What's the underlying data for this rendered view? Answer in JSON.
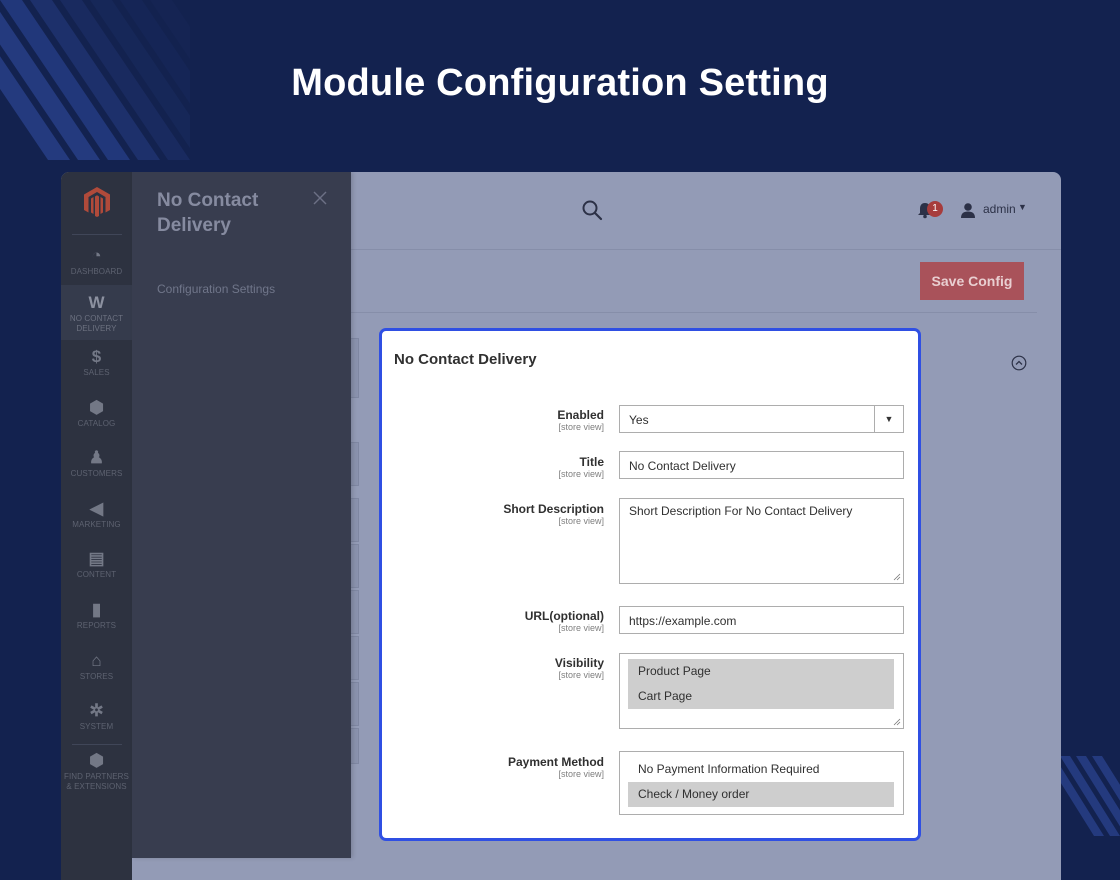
{
  "hero": {
    "title": "Module Configuration Setting"
  },
  "colors": {
    "background": "#13224f",
    "accent_border": "#2f4fe3",
    "save_button": "#a9525a",
    "nav": "#2d3240"
  },
  "header": {
    "notification_count": "1",
    "user": "admin",
    "save_button": "Save Config",
    "icons": [
      "search-icon",
      "bell-icon",
      "user-icon",
      "magento-logo-icon",
      "collapse-icon"
    ]
  },
  "nav": {
    "items": [
      {
        "label": "DASHBOARD",
        "icon": "dashboard-icon"
      },
      {
        "label": "NO CONTACT DELIVERY",
        "icon": "w-logo-icon"
      },
      {
        "label": "SALES",
        "icon": "dollar-icon"
      },
      {
        "label": "CATALOG",
        "icon": "cube-icon"
      },
      {
        "label": "CUSTOMERS",
        "icon": "person-icon"
      },
      {
        "label": "MARKETING",
        "icon": "megaphone-icon"
      },
      {
        "label": "CONTENT",
        "icon": "layout-icon"
      },
      {
        "label": "REPORTS",
        "icon": "bar-chart-icon"
      },
      {
        "label": "STORES",
        "icon": "store-icon"
      },
      {
        "label": "SYSTEM",
        "icon": "gear-icon"
      },
      {
        "label": "FIND PARTNERS & EXTENSIONS",
        "icon": "box-icon"
      }
    ]
  },
  "flyout": {
    "title": "No Contact Delivery",
    "link": "Configuration Settings"
  },
  "config": {
    "section_title": "No Contact Delivery",
    "scope_label": "[store view]",
    "fields": {
      "enabled": {
        "label": "Enabled",
        "value": "Yes"
      },
      "title": {
        "label": "Title",
        "value": "No Contact Delivery"
      },
      "short_description": {
        "label": "Short Description",
        "value": "Short Description For No Contact Delivery"
      },
      "url": {
        "label": "URL(optional)",
        "value": "https://example.com"
      },
      "visibility": {
        "label": "Visibility",
        "options": [
          "Product Page",
          "Cart Page"
        ],
        "selected": [
          "Product Page",
          "Cart Page"
        ]
      },
      "payment_method": {
        "label": "Payment Method",
        "options": [
          "No Payment Information Required",
          "Check / Money order"
        ],
        "selected": [
          "Check / Money order"
        ]
      }
    }
  }
}
